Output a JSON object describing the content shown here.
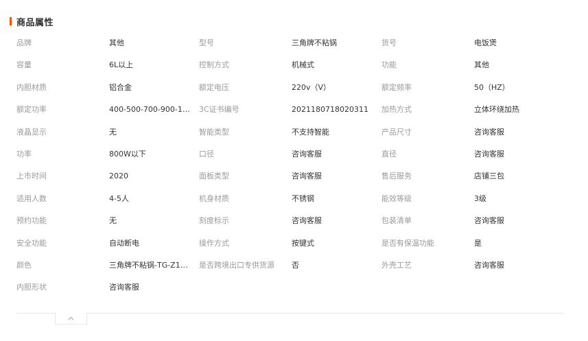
{
  "section": {
    "title": "商品属性",
    "accent_color": "#ff5000"
  },
  "attributes": [
    [
      {
        "label": "品牌",
        "value": "其他"
      },
      {
        "label": "型号",
        "value": "三角牌不粘锅"
      },
      {
        "label": "货号",
        "value": "电饭煲"
      }
    ],
    [
      {
        "label": "容量",
        "value": "6L以上"
      },
      {
        "label": "控制方式",
        "value": "机械式"
      },
      {
        "label": "功能",
        "value": "其他"
      }
    ],
    [
      {
        "label": "内胆材质",
        "value": "铝合金"
      },
      {
        "label": "额定电压",
        "value": "220v（V）"
      },
      {
        "label": "额定频率",
        "value": "50（HZ）"
      }
    ],
    [
      {
        "label": "额定功率",
        "value": "400-500-700-900-100..."
      },
      {
        "label": "3C证书编号",
        "value": "2021180718020311"
      },
      {
        "label": "加热方式",
        "value": "立体环绕加热"
      }
    ],
    [
      {
        "label": "液晶显示",
        "value": "无"
      },
      {
        "label": "智能类型",
        "value": "不支持智能"
      },
      {
        "label": "产品尺寸",
        "value": "咨询客服"
      }
    ],
    [
      {
        "label": "功率",
        "value": "800W以下"
      },
      {
        "label": "口径",
        "value": "咨询客服"
      },
      {
        "label": "直径",
        "value": "咨询客服"
      }
    ],
    [
      {
        "label": "上市时间",
        "value": "2020"
      },
      {
        "label": "面板类型",
        "value": "咨询客服"
      },
      {
        "label": "售后服务",
        "value": "店铺三包"
      }
    ],
    [
      {
        "label": "适用人数",
        "value": "4-5人"
      },
      {
        "label": "机身材质",
        "value": "不锈钢"
      },
      {
        "label": "能效等级",
        "value": "3级"
      }
    ],
    [
      {
        "label": "预约功能",
        "value": "无"
      },
      {
        "label": "刻度标示",
        "value": "咨询客服"
      },
      {
        "label": "包装清单",
        "value": "咨询客服"
      }
    ],
    [
      {
        "label": "安全功能",
        "value": "自动断电"
      },
      {
        "label": "操作方式",
        "value": "按键式"
      },
      {
        "label": "是否有保温功能",
        "value": "是"
      }
    ],
    [
      {
        "label": "颜色",
        "value": "三角牌不粘锅-TG-Z15..."
      },
      {
        "label": "是否跨境出口专供货源",
        "value": "否"
      },
      {
        "label": "外壳工艺",
        "value": "咨询客服"
      }
    ],
    [
      {
        "label": "内胆形状",
        "value": "咨询客服"
      }
    ]
  ],
  "collapse_toggle": {
    "icon": "chevron-up-icon"
  }
}
